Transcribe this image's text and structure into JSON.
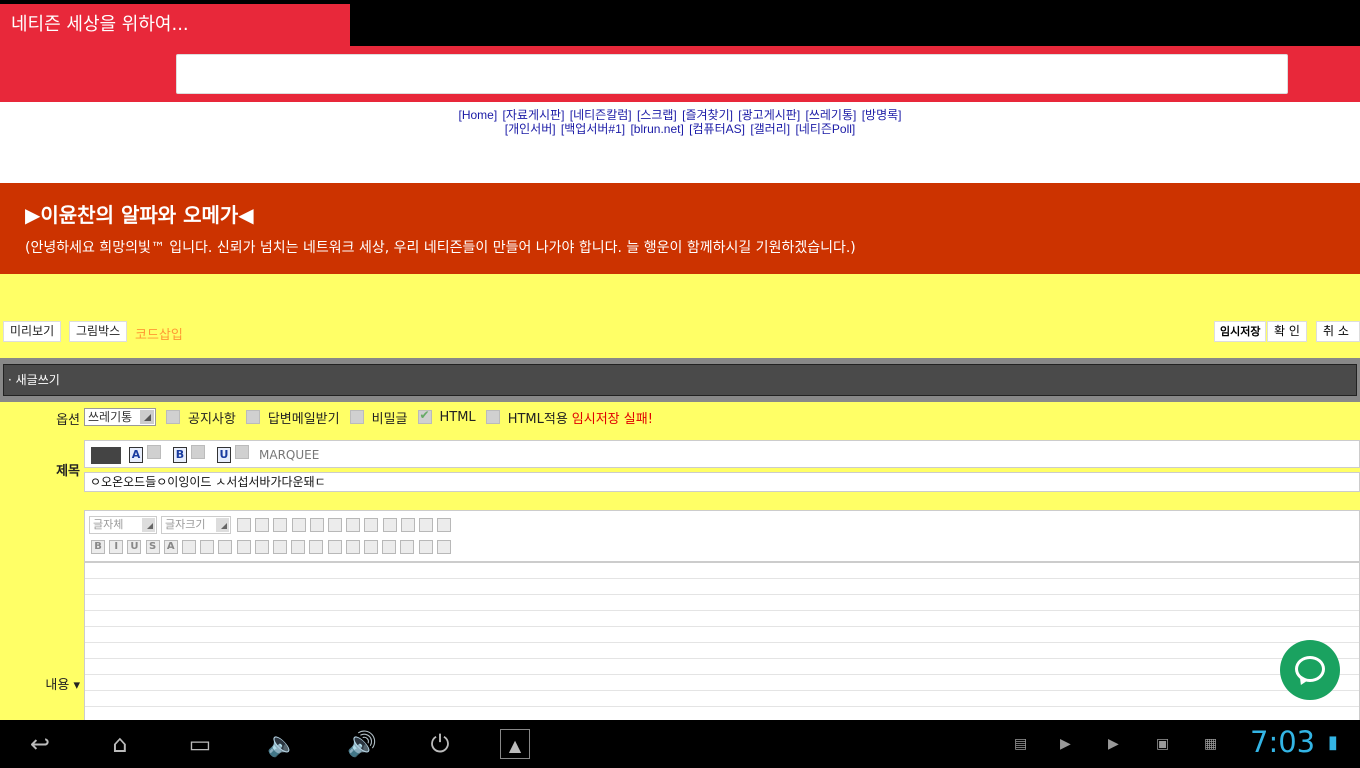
{
  "browser": {
    "tab_title": "네티즌 세상을 위하여...",
    "url_value": ""
  },
  "nav": {
    "row1": [
      "[Home]",
      "[자료게시판]",
      "[네티즌칼럼]",
      "[스크랩]",
      "[즐겨찾기]",
      "[광고게시판]",
      "[쓰레기통]",
      "[방명록]"
    ],
    "row2": [
      "[개인서버]",
      "[백업서버#1]",
      "[blrun.net]",
      "[컴퓨터AS]",
      "[갤러리]",
      "[네티즌Poll]"
    ]
  },
  "banner": {
    "title": "▶이윤찬의 알파와 오메가◀",
    "subtitle": "(안녕하세요 희망의빛™ 입니다. 신뢰가 넘치는 네트워크 세상, 우리 네티즌들이 만들어 나가야 합니다. 늘 행운이 함께하시길 기원하겠습니다.)"
  },
  "toolbar": {
    "preview": "미리보기",
    "image_box": "그림박스",
    "code_insert": "코드삽입",
    "temp_save": "임시저장",
    "confirm": "확  인",
    "cancel": "취  소"
  },
  "newpost": {
    "label": "· 새글쓰기"
  },
  "options": {
    "label": "옵션",
    "category_selected": "쓰레기통",
    "notice": "공지사항",
    "reply_mail": "답변메일받기",
    "secret": "비밀글",
    "html": "HTML",
    "html_apply": "HTML적용",
    "save_status": "임시저장 실패!",
    "html_checked": true
  },
  "subject": {
    "label": "제목",
    "marquee": "MARQUEE",
    "value": "ㅇ오온오드들ㅇ이잉이드 ㅅ서섭서바가다운돼ㄷ",
    "icons": [
      "font-color-icon",
      "bold-icon",
      "underline-icon"
    ]
  },
  "content": {
    "label": "내용 ▾",
    "font_select": "글자체",
    "size_select": "글자크기"
  },
  "system": {
    "clock": "7:03"
  },
  "colors": {
    "title_red": "#e8283a",
    "banner_orange": "#cc3300",
    "page_yellow": "#ffff66",
    "clock_blue": "#33b5e5",
    "fab_green": "#1aa260"
  }
}
